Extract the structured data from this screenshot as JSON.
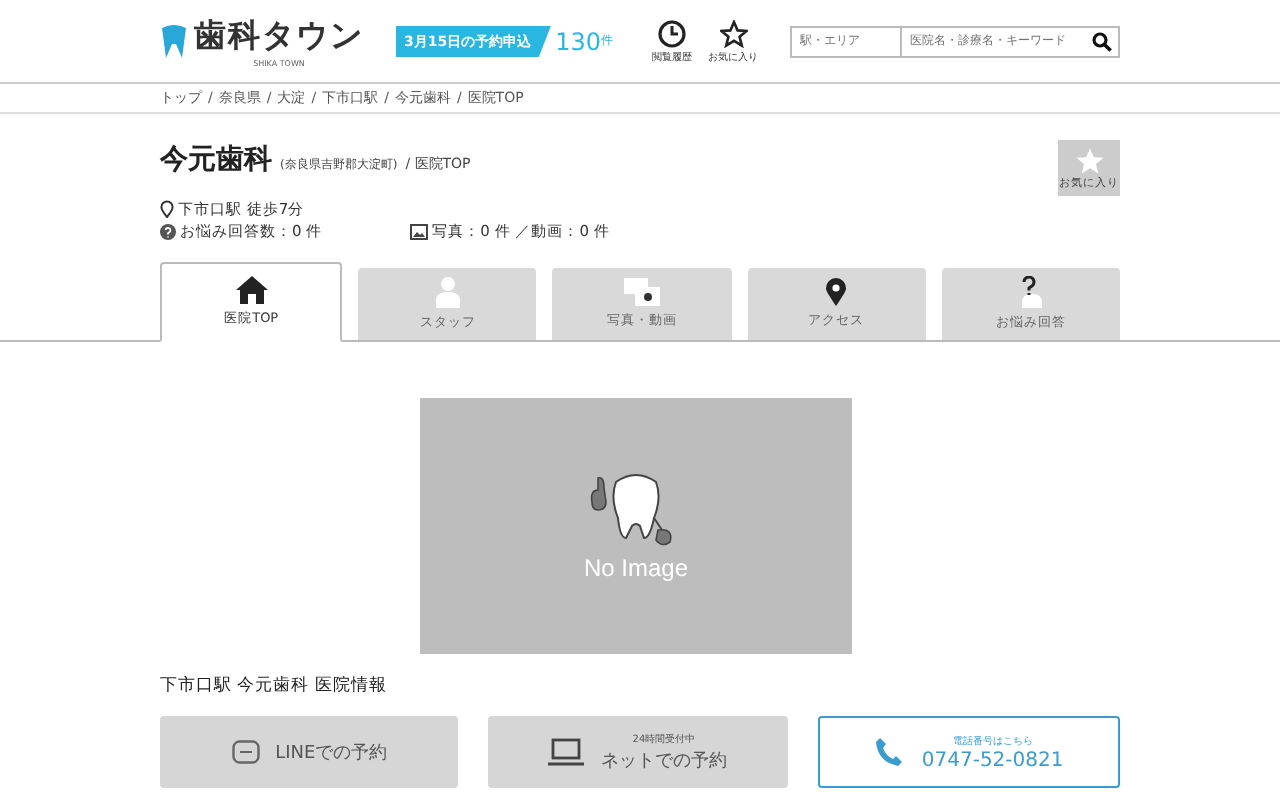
{
  "header": {
    "logo": "歯科タウン",
    "logo_sub": "SHIKA TOWN",
    "banner": {
      "date": "3月15日の予約申込",
      "count": "130",
      "unit": "件"
    },
    "icons": [
      {
        "kind": "history",
        "label": "閲覧履歴"
      },
      {
        "kind": "favorite",
        "label": "お気に入り"
      }
    ],
    "search": [
      {
        "placeholder": "駅・エリア"
      },
      {
        "placeholder": "医院名・診療名・キーワード"
      }
    ]
  },
  "breadcrumb_separator": "/",
  "breadcrumb": [
    "トップ",
    "奈良県",
    "大淀",
    "下市口駅",
    "今元歯科",
    "医院TOP"
  ],
  "clinic": {
    "name": "今元歯科",
    "location": "(奈良県吉野郡大淀町)",
    "page": "/ 医院TOP",
    "favorite_label": "お気に入り",
    "station": "下市口駅 徒歩7分",
    "answers": "お悩み回答数：0 件",
    "media": "写真：0 件 ／動画：0 件"
  },
  "tabs": [
    {
      "kind": "home",
      "label": "医院TOP",
      "selected": true
    },
    {
      "kind": "staff",
      "label": "スタッフ",
      "selected": false
    },
    {
      "kind": "photo",
      "label": "写真・動画",
      "selected": false
    },
    {
      "kind": "access",
      "label": "アクセス",
      "selected": false
    },
    {
      "kind": "faq",
      "label": "お悩み回答",
      "selected": false
    }
  ],
  "photo": {
    "caption": "No Image"
  },
  "section_title": "下市口駅 今元歯科 医院情報",
  "actions": [
    {
      "kind": "line",
      "label": "LINEでの予約"
    },
    {
      "kind": "net",
      "note": "24時間受付中",
      "label": "ネットでの予約"
    },
    {
      "kind": "phone",
      "note": "電話番号はこちら",
      "label": "0747-52-0821"
    }
  ]
}
